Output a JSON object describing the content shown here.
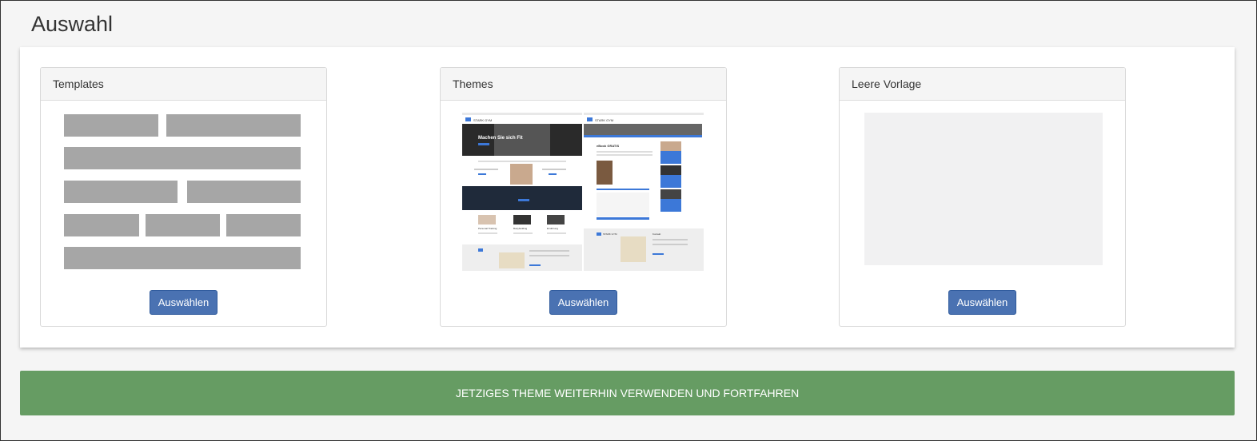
{
  "page": {
    "title": "Auswahl"
  },
  "cards": [
    {
      "title": "Templates",
      "button_label": "Auswählen"
    },
    {
      "title": "Themes",
      "button_label": "Auswählen"
    },
    {
      "title": "Leere Vorlage",
      "button_label": "Auswählen"
    }
  ],
  "theme_preview": {
    "hero_text": "Machen Sie sich Fit",
    "brand_left": "STARK GYM",
    "brand_right": "STARK GYM",
    "article_title": "eBook GRATIS",
    "tiles": [
      "Personal Training",
      "Bodybuilding",
      "Ernährung"
    ],
    "footer_brand": "STARK GYM",
    "footer_title": "Kontakt",
    "colors": {
      "accent": "#3c78d8",
      "dark": "#222222"
    }
  },
  "footer": {
    "continue_label": "JETZIGES THEME WEITERHIN VERWENDEN UND FORTFAHREN"
  },
  "colors": {
    "primary_button": "#4a72b2",
    "continue_bar": "#669c63",
    "placeholder_block": "#a6a6a6"
  }
}
